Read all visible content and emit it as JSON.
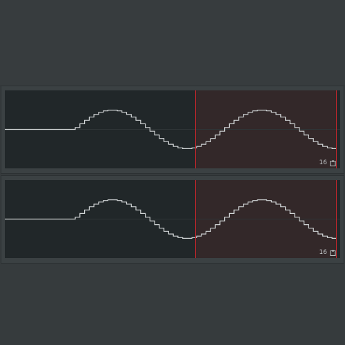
{
  "panels": [
    {
      "step_count": "16",
      "icon": "clipboard-icon",
      "shape": "stepped-sine",
      "flat_portion": 0.21,
      "loop_start_fraction": 0.58,
      "steps_per_cycle": 64
    },
    {
      "step_count": "16",
      "icon": "clipboard-icon",
      "shape": "stepped-sine",
      "flat_portion": 0.21,
      "loop_start_fraction": 0.58,
      "steps_per_cycle": 64
    }
  ],
  "colors": {
    "background": "#363b3d",
    "panel_frame": "#3b4143",
    "graph_bg": "#212729",
    "loop_region": "#332829",
    "loop_marker": "#c0262b",
    "curve": "#d2d6d7",
    "center_line": "#2f3537"
  }
}
